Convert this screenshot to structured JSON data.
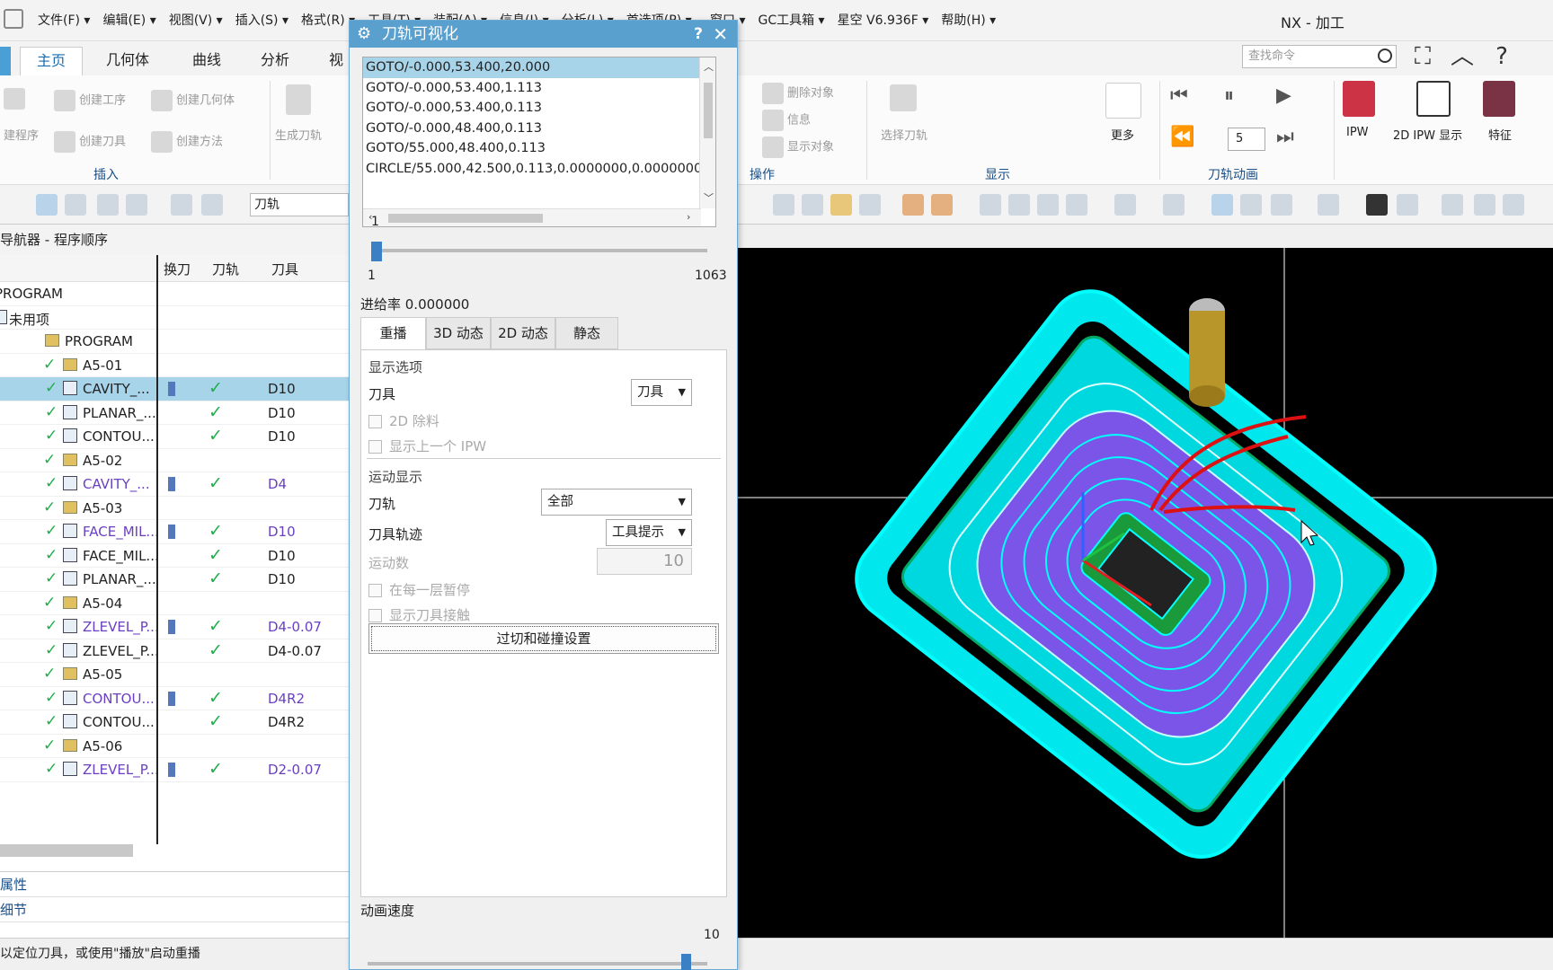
{
  "menubar": {
    "items": [
      "文件(F) ▾",
      "编辑(E) ▾",
      "视图(V) ▾",
      "插入(S) ▾",
      "格式(R) ▾",
      "工具(T) ▾",
      "装配(A) ▾",
      "信息(I) ▾",
      "分析(L) ▾",
      "首选项(P) ▾"
    ],
    "right_items": [
      "窗口 ▾",
      "GC工具箱 ▾",
      "星空 V6.936F ▾",
      "帮助(H) ▾"
    ],
    "title": "NX - 加工"
  },
  "ribbon_tabs": [
    "主页",
    "几何体",
    "曲线",
    "分析",
    "视"
  ],
  "search": {
    "placeholder": "查找命令"
  },
  "ribbon": {
    "insert": {
      "create_program": "建程序",
      "create_operation": "创建工序",
      "create_geometry": "创建几何体",
      "create_tool": "创建刀具",
      "create_method": "创建方法",
      "group": "插入"
    },
    "generate_toolpath": "生成刀轨",
    "operations": {
      "delete_object": "删除对象",
      "info": "信息",
      "show_object": "显示对象",
      "group": "操作"
    },
    "display": {
      "select_toolpath": "选择刀轨",
      "more": "更多",
      "group": "显示"
    },
    "animation": {
      "step": "5",
      "group": "刀轨动画"
    },
    "ipw": "IPW",
    "ipw2d": "2D IPW 显示",
    "feature": "特征"
  },
  "toolbar": {
    "filter_value": "刀轨"
  },
  "navigator": {
    "title": "导航器 - 程序顺序",
    "columns": {
      "tool_change": "换刀",
      "path": "刀轨",
      "tool": "刀具"
    },
    "rows": [
      {
        "name": "PROGRAM",
        "indent": 0,
        "kind": "text",
        "tool": ""
      },
      {
        "name": "未用项",
        "indent": 0,
        "kind": "root",
        "tool": ""
      },
      {
        "name": "PROGRAM",
        "indent": 1,
        "kind": "folder",
        "tool": ""
      },
      {
        "name": "A5-01",
        "indent": 2,
        "kind": "folder",
        "tool": ""
      },
      {
        "name": "CAVITY_...",
        "indent": 3,
        "kind": "op",
        "tc": true,
        "tool": "D10",
        "sel": true
      },
      {
        "name": "PLANAR_...",
        "indent": 3,
        "kind": "op",
        "tool": "D10"
      },
      {
        "name": "CONTOU...",
        "indent": 3,
        "kind": "op",
        "tool": "D10"
      },
      {
        "name": "A5-02",
        "indent": 2,
        "kind": "folder",
        "tool": ""
      },
      {
        "name": "CAVITY_...",
        "indent": 3,
        "kind": "op",
        "tc": true,
        "tool": "D4",
        "purple": true
      },
      {
        "name": "A5-03",
        "indent": 2,
        "kind": "folder",
        "tool": ""
      },
      {
        "name": "FACE_MIL...",
        "indent": 3,
        "kind": "op",
        "tc": true,
        "tool": "D10",
        "purple": true
      },
      {
        "name": "FACE_MIL...",
        "indent": 3,
        "kind": "op",
        "tool": "D10"
      },
      {
        "name": "PLANAR_...",
        "indent": 3,
        "kind": "op",
        "tool": "D10"
      },
      {
        "name": "A5-04",
        "indent": 2,
        "kind": "folder",
        "tool": ""
      },
      {
        "name": "ZLEVEL_P...",
        "indent": 3,
        "kind": "op",
        "tc": true,
        "tool": "D4-0.07",
        "purple": true
      },
      {
        "name": "ZLEVEL_P...",
        "indent": 3,
        "kind": "op",
        "tool": "D4-0.07"
      },
      {
        "name": "A5-05",
        "indent": 2,
        "kind": "folder",
        "tool": ""
      },
      {
        "name": "CONTOU...",
        "indent": 3,
        "kind": "op",
        "tc": true,
        "tool": "D4R2",
        "purple": true
      },
      {
        "name": "CONTOU...",
        "indent": 3,
        "kind": "op",
        "tool": "D4R2"
      },
      {
        "name": "A5-06",
        "indent": 2,
        "kind": "folder",
        "tool": ""
      },
      {
        "name": "ZLEVEL_P...",
        "indent": 3,
        "kind": "op",
        "tc": true,
        "tool": "D2-0.07",
        "purple": true
      }
    ]
  },
  "bottom_panels": [
    "属性",
    "细节"
  ],
  "status_text": "以定位刀具，或使用\"播放\"启动重播",
  "dialog": {
    "title": "刀轨可视化",
    "help": "?",
    "close": "✕",
    "cl_list": [
      "GOTO/-0.000,53.400,20.000",
      "GOTO/-0.000,53.400,1.113",
      "GOTO/-0.000,53.400,0.113",
      "GOTO/-0.000,48.400,0.113",
      "GOTO/55.000,48.400,0.113",
      "CIRCLE/55.000,42.500,0.113,0.0000000,0.0000000,"
    ],
    "position_value": "1",
    "position_fraction": 0,
    "slider_min": "1",
    "slider_max": "1063",
    "feed_rate": "进给率 0.000000",
    "tabs": [
      "重播",
      "3D 动态",
      "2D 动态",
      "静态"
    ],
    "display_options_label": "显示选项",
    "tool_label": "刀具",
    "tool_value": "刀具",
    "cb_2d_removal": "2D 除料",
    "cb_prev_ipw": "显示上一个 IPW",
    "motion_display_label": "运动显示",
    "path_label": "刀轨",
    "path_value": "全部",
    "tool_trace_label": "刀具轨迹",
    "tool_trace_value": "工具提示",
    "motion_count_label": "运动数",
    "motion_count_value": "10",
    "cb_pause_layer": "在每一层暂停",
    "cb_show_contact": "显示刀具接触",
    "gouge_button": "过切和碰撞设置",
    "speed_label": "动画速度",
    "speed_value": "10",
    "speed_fraction": 0.95
  },
  "viewport": {
    "background": "#000000",
    "part_color": "#00ffff",
    "cavity_color": "#8a5cf0",
    "annotation_color": "#dd1111"
  }
}
